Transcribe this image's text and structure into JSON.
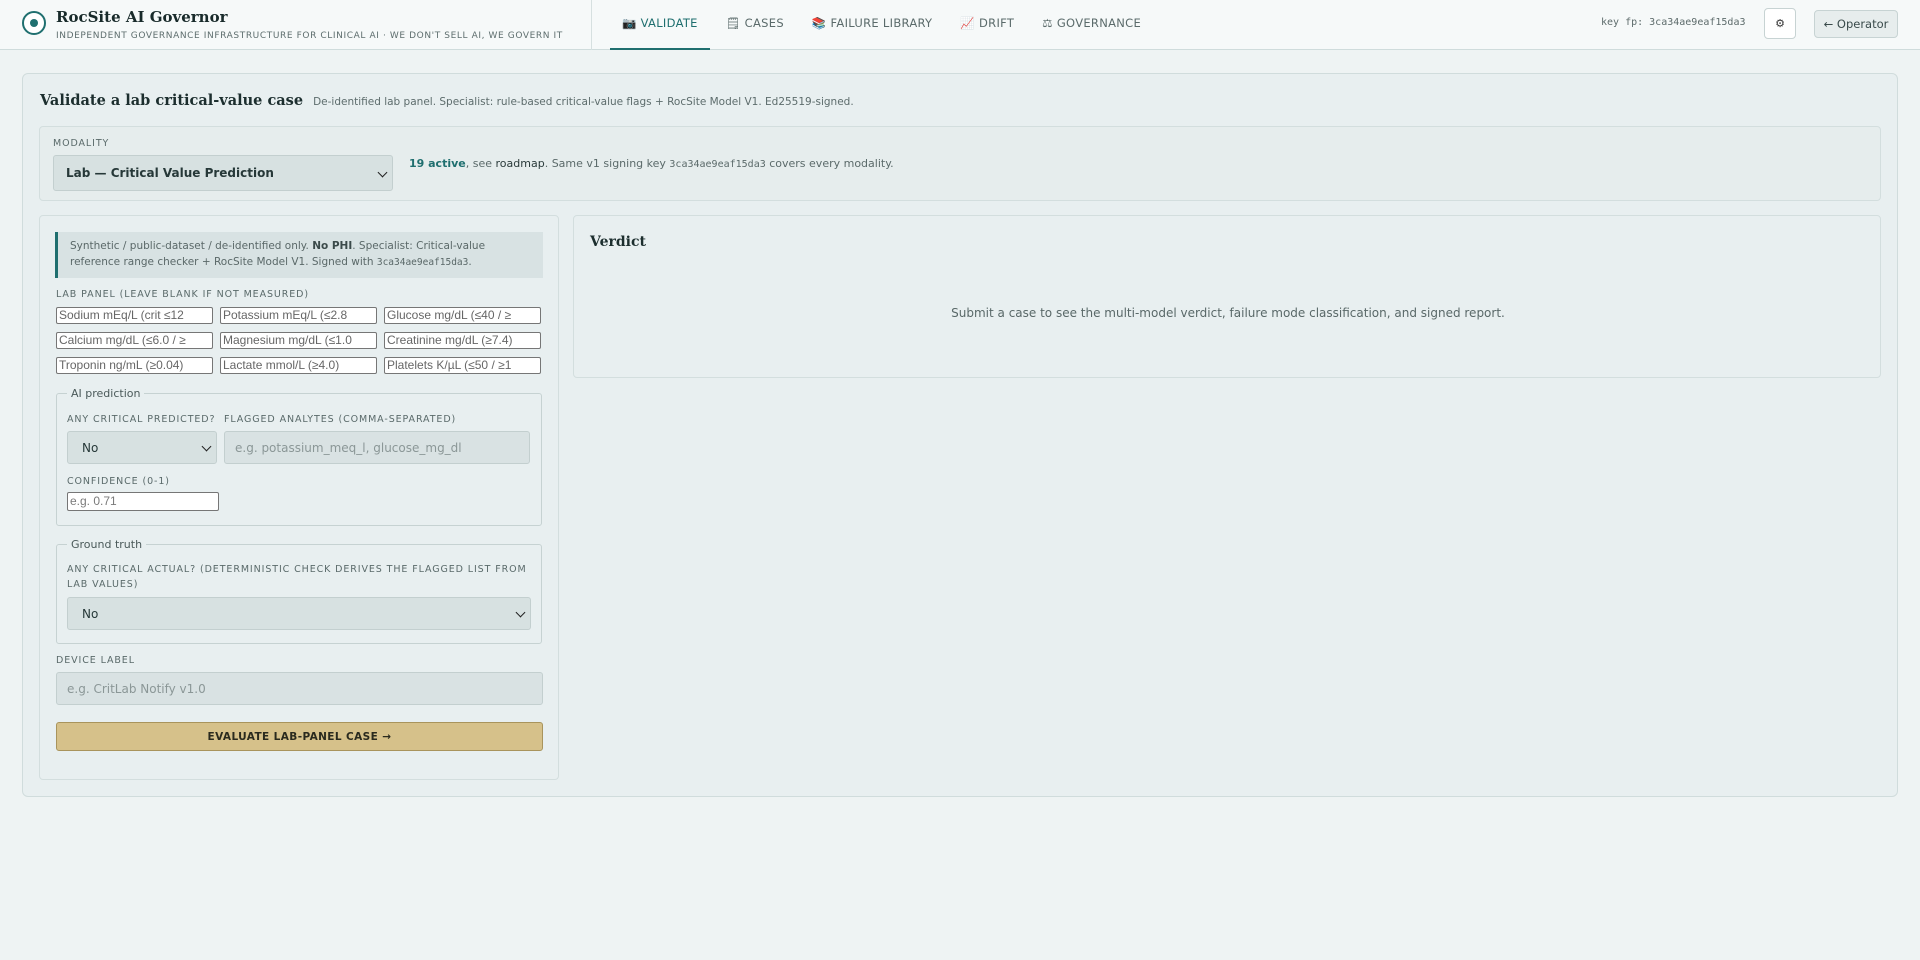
{
  "header": {
    "title": "RocSite AI Governor",
    "subtitle": "INDEPENDENT GOVERNANCE INFRASTRUCTURE FOR CLINICAL AI · WE DON'T SELL AI, WE GOVERN IT",
    "key_fp": "key fp: 3ca34ae9eaf15da3",
    "settings_icon": "⚙",
    "operator_label": "← Operator"
  },
  "nav": {
    "tabs": [
      {
        "icon": "📷",
        "label": "VALIDATE",
        "active": true
      },
      {
        "icon": "🗒",
        "label": "CASES"
      },
      {
        "icon": "📚",
        "label": "FAILURE LIBRARY"
      },
      {
        "icon": "📈",
        "label": "DRIFT"
      },
      {
        "icon": "⚖",
        "label": "GOVERNANCE"
      }
    ]
  },
  "main": {
    "title": "Validate a lab critical-value case",
    "description": "De-identified lab panel. Specialist: rule-based critical-value flags + RocSite Model V1. Ed25519-signed.",
    "modality": {
      "label": "MODALITY",
      "selected": "Lab — Critical Value Prediction",
      "active_count": "19 active",
      "note_mid": ", see ",
      "roadmap": "roadmap",
      "note_after": ". Same v1 signing key ",
      "key": "3ca34ae9eaf15da3",
      "note_end": " covers every modality."
    }
  },
  "form": {
    "notice_pre": "Synthetic / public-dataset / de-identified only. ",
    "notice_bold": "No PHI",
    "notice_post": ". Specialist: Critical-value reference range checker + RocSite Model V1. Signed with ",
    "notice_key": "3ca34ae9eaf15da3",
    "notice_tail": ".",
    "lab_panel_label": "LAB PANEL (LEAVE BLANK IF NOT MEASURED)",
    "lab_inputs": [
      "Sodium mEq/L (crit ≤12",
      "Potassium mEq/L (≤2.8",
      "Glucose mg/dL (≤40 / ≥",
      "Calcium mg/dL (≤6.0 / ≥",
      "Magnesium mg/dL (≤1.0",
      "Creatinine mg/dL (≥7.4)",
      "Troponin ng/mL (≥0.04)",
      "Lactate mmol/L (≥4.0)",
      "Platelets K/µL (≤50 / ≥1"
    ],
    "ai_prediction": {
      "legend": "AI prediction",
      "any_critical_label": "ANY CRITICAL PREDICTED?",
      "any_critical_value": "No",
      "flagged_label": "FLAGGED ANALYTES (COMMA-SEPARATED)",
      "flagged_placeholder": "e.g. potassium_meq_l, glucose_mg_dl",
      "confidence_label": "CONFIDENCE (0-1)",
      "confidence_placeholder": "e.g. 0.71"
    },
    "ground_truth": {
      "legend": "Ground truth",
      "label": "ANY CRITICAL ACTUAL? (DETERMINISTIC CHECK DERIVES THE FLAGGED LIST FROM LAB VALUES)",
      "value": "No"
    },
    "device_label": "DEVICE LABEL",
    "device_placeholder": "e.g. CritLab Notify v1.0",
    "submit_label": "EVALUATE LAB-PANEL CASE →"
  },
  "verdict": {
    "title": "Verdict",
    "empty_text": "Submit a case to see the multi-model verdict, failure mode classification, and signed report."
  }
}
